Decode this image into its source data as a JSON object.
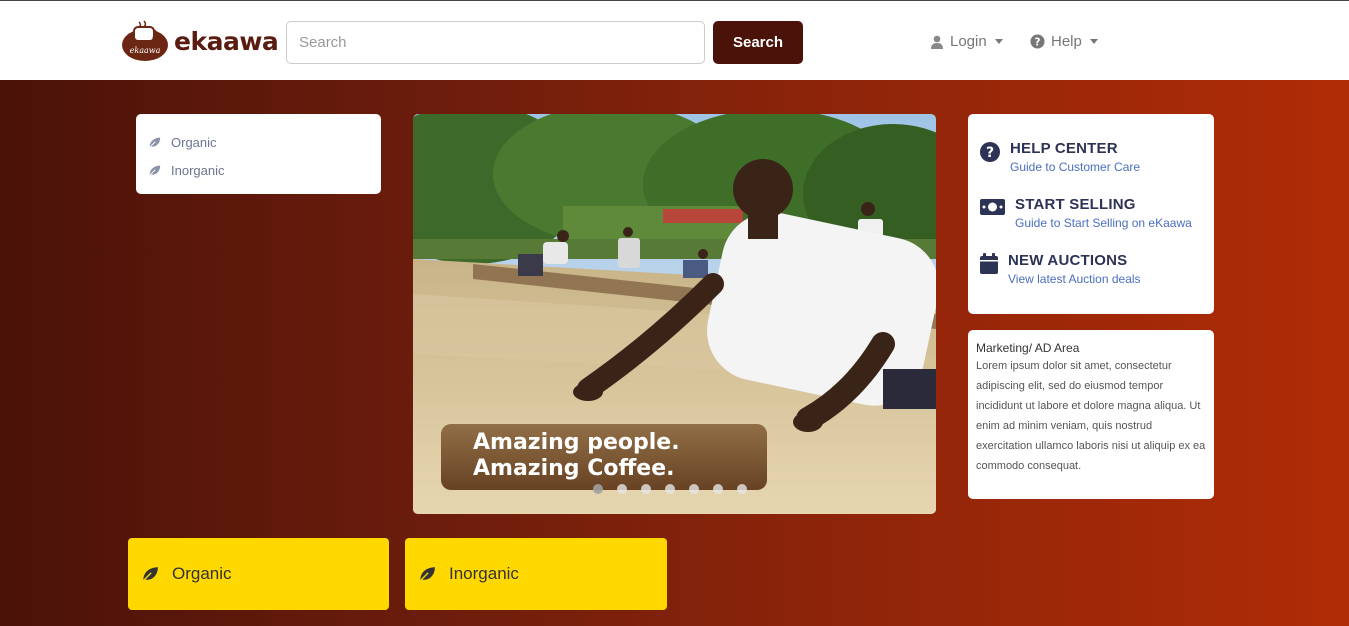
{
  "header": {
    "logo": {
      "text": "ekaawa",
      "badge_text": "ekaawa"
    },
    "search": {
      "placeholder": "Search",
      "button_label": "Search"
    },
    "nav": {
      "login_label": "Login",
      "help_label": "Help"
    }
  },
  "sidebar_categories": {
    "items": [
      {
        "label": "Organic",
        "icon": "leaf-icon"
      },
      {
        "label": "Inorganic",
        "icon": "leaf-icon"
      }
    ]
  },
  "carousel": {
    "caption_line1": "Amazing people.",
    "caption_line2": "Amazing Coffee.",
    "slide_count": 7,
    "active_index": 0
  },
  "help_panel": {
    "items": [
      {
        "title": "HELP CENTER",
        "subtitle": "Guide to Customer Care",
        "icon": "question-circle-icon"
      },
      {
        "title": "START SELLING",
        "subtitle": "Guide to Start Selling on eKaawa",
        "icon": "money-bill-icon"
      },
      {
        "title": "NEW AUCTIONS",
        "subtitle": "View latest Auction deals",
        "icon": "calendar-icon"
      }
    ]
  },
  "ad_area": {
    "title": "Marketing/ AD Area",
    "body": "Lorem ipsum dolor sit amet, consectetur adipiscing elit, sed do eiusmod tempor incididunt ut labore et dolore magna aliqua. Ut enim ad minim veniam, quis nostrud exercitation ullamco laboris nisi ut aliquip ex ea commodo consequat."
  },
  "category_tiles": [
    {
      "label": "Organic",
      "icon": "leaf-icon"
    },
    {
      "label": "Inorganic",
      "icon": "leaf-icon"
    }
  ],
  "colors": {
    "brand": "#5a1c10",
    "search_button": "#4a1208",
    "tile": "#ffd800",
    "link": "#4a6ec0"
  }
}
